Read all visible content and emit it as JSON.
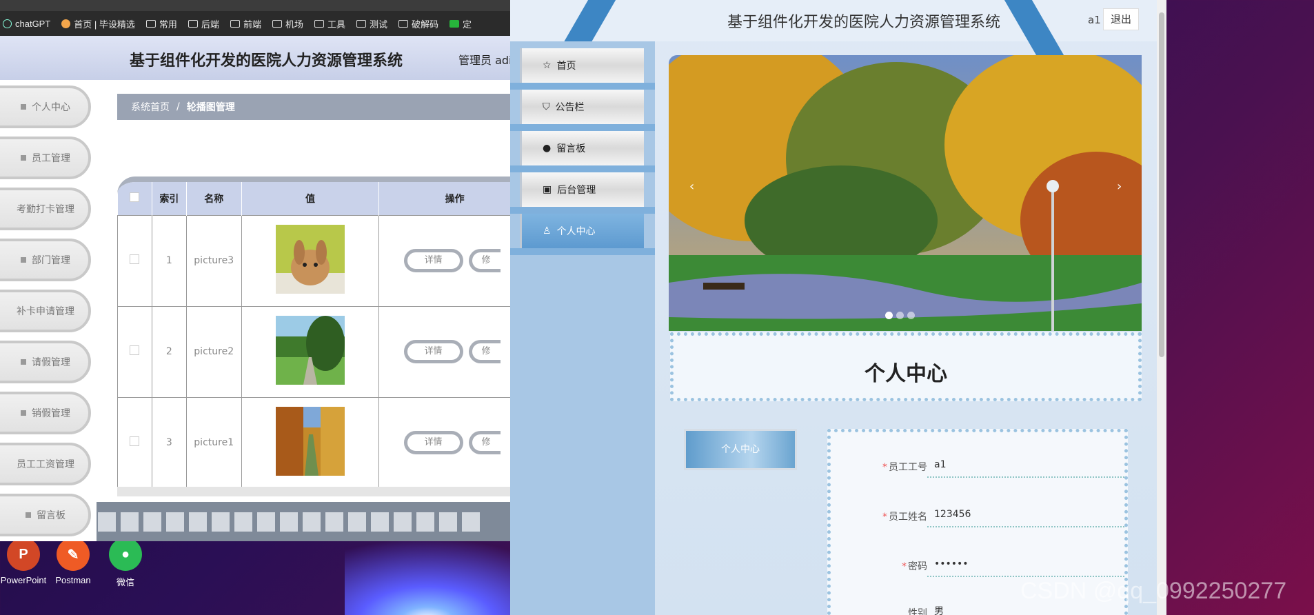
{
  "bookmarks": [
    "chatGPT",
    "首页 | 毕设精选",
    "常用",
    "后端",
    "前端",
    "机场",
    "工具",
    "测试",
    "破解码",
    "定"
  ],
  "left": {
    "title": "基于组件化开发的医院人力资源管理系统",
    "admin": "管理员 adi",
    "sidebar": [
      "个人中心",
      "员工管理",
      "考勤打卡管理",
      "部门管理",
      "补卡申请管理",
      "请假管理",
      "销假管理",
      "员工工资管理",
      "留言板"
    ],
    "breadcrumb": {
      "home": "系统首页",
      "sep": "/",
      "current": "轮播图管理"
    },
    "table": {
      "headers": [
        "索引",
        "名称",
        "值",
        "操作"
      ],
      "rows": [
        {
          "index": "1",
          "name": "picture3",
          "detail": "详情",
          "edit": "修"
        },
        {
          "index": "2",
          "name": "picture2",
          "detail": "详情",
          "edit": "修"
        },
        {
          "index": "3",
          "name": "picture1",
          "detail": "详情",
          "edit": "修"
        }
      ]
    }
  },
  "right": {
    "title": "基于组件化开发的医院人力资源管理系统",
    "user": "a1",
    "logout": "退出",
    "nav": [
      "首页",
      "公告栏",
      "留言板",
      "后台管理",
      "个人中心"
    ],
    "section_title": "个人中心",
    "side_button": "个人中心",
    "form": [
      {
        "label": "员工工号",
        "value": "a1",
        "required": "*"
      },
      {
        "label": "员工姓名",
        "value": "123456",
        "required": "*"
      },
      {
        "label": "密码",
        "value": "••••••",
        "required": "*"
      },
      {
        "label": "性别",
        "value": "男",
        "required": ""
      }
    ],
    "carousel": {
      "prev": "‹",
      "next": "›"
    }
  },
  "desktop": {
    "icons": [
      "PowerPoint",
      "Postman",
      "微信"
    ]
  },
  "watermark": "CSDN @qq_0992250277",
  "colors": {
    "accent": "#3d86c4",
    "nav": "#a8c7e5",
    "left_header": "#c7cfe8"
  }
}
